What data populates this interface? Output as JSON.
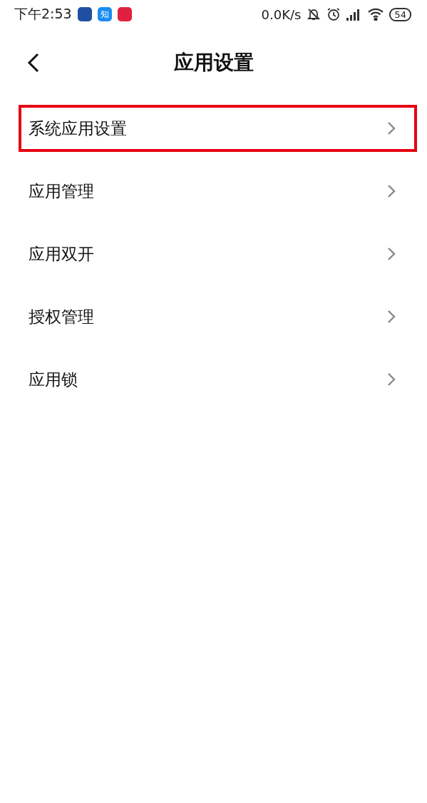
{
  "status_bar": {
    "time": "下午2:53",
    "notification_apps": [
      {
        "kind": "app",
        "color": "#1f4fa0"
      },
      {
        "kind": "letter",
        "label": "知",
        "color": "#1a8cf0"
      },
      {
        "kind": "app",
        "color": "#e02040"
      }
    ],
    "network_speed": "0.0K/s",
    "battery": "54"
  },
  "header": {
    "title": "应用设置"
  },
  "items": [
    {
      "label": "系统应用设置",
      "highlighted": true
    },
    {
      "label": "应用管理",
      "highlighted": false
    },
    {
      "label": "应用双开",
      "highlighted": false
    },
    {
      "label": "授权管理",
      "highlighted": false
    },
    {
      "label": "应用锁",
      "highlighted": false
    }
  ]
}
